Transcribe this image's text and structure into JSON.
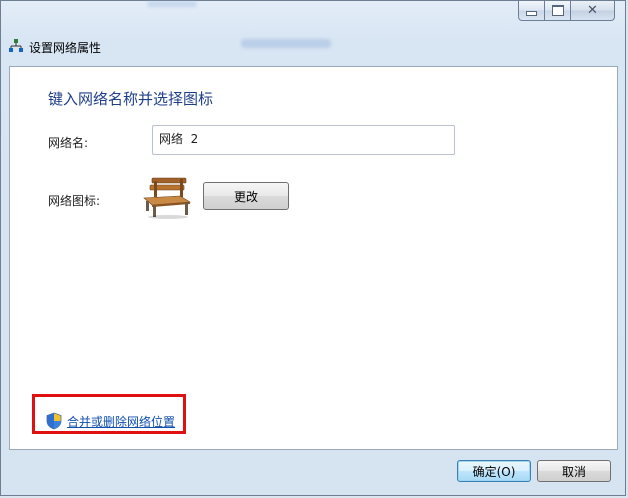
{
  "window": {
    "title": "设置网络属性",
    "caption_buttons": {
      "minimize": "minimize",
      "maximize": "maximize",
      "close": "✕"
    }
  },
  "content": {
    "heading": "键入网络名称并选择图标",
    "network_name_label": "网络名:",
    "network_name_value": "网络  2",
    "network_icon_label": "网络图标:",
    "change_button": "更改",
    "merge_link": "合并或删除网络位置"
  },
  "footer": {
    "ok_button": "确定(O)",
    "cancel_button": "取消"
  },
  "colors": {
    "heading": "#1f3e8a",
    "link": "#0f4fb0",
    "highlight": "#e01010"
  }
}
